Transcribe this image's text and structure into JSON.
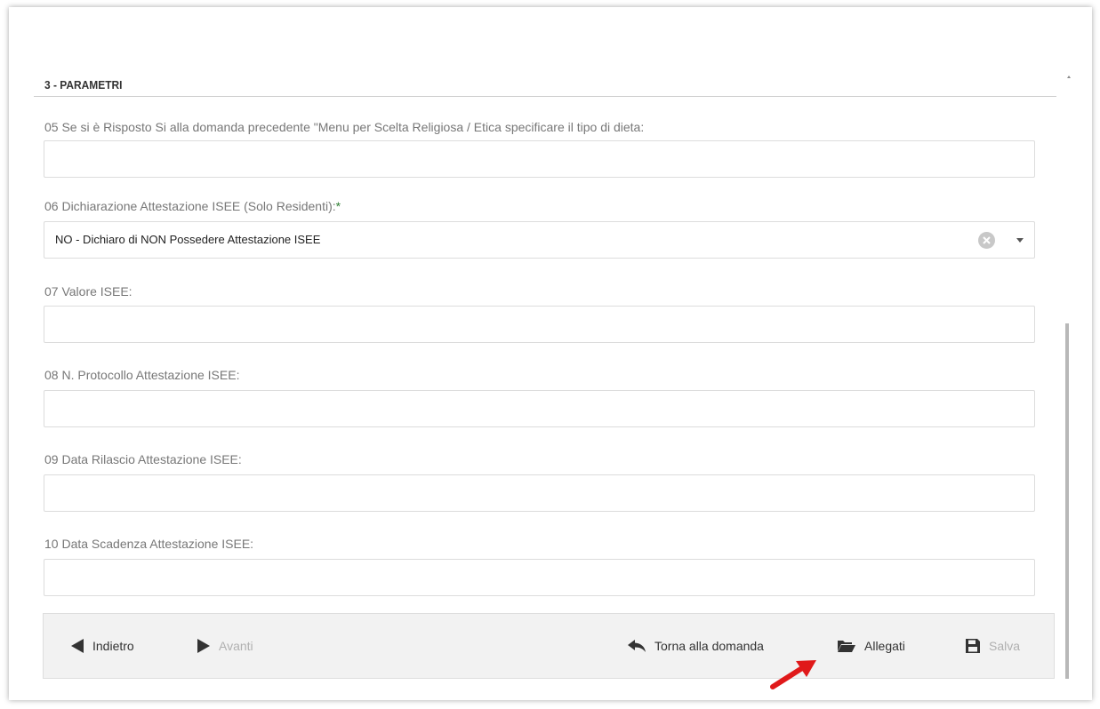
{
  "section": {
    "title": "3 - PARAMETRI"
  },
  "fields": [
    {
      "label": "05 Se si è Risposto Si alla domanda precedente \"Menu per Scelta Religiosa / Etica specificare il tipo di dieta:",
      "value": ""
    },
    {
      "label": "06 Dichiarazione Attestazione ISEE (Solo Residenti):",
      "required": "*",
      "value": "NO - Dichiaro di NON Possedere Attestazione ISEE"
    },
    {
      "label": "07 Valore ISEE:",
      "value": ""
    },
    {
      "label": "08 N. Protocollo Attestazione ISEE:",
      "value": ""
    },
    {
      "label": "09 Data Rilascio Attestazione ISEE:",
      "value": ""
    },
    {
      "label": "10 Data Scadenza Attestazione ISEE:",
      "value": ""
    }
  ],
  "toolbar": {
    "back": {
      "label": "Indietro",
      "icon": "triangle-left-icon"
    },
    "next": {
      "label": "Avanti",
      "icon": "triangle-right-icon",
      "disabled": true
    },
    "return": {
      "label": "Torna alla domanda",
      "icon": "reply-icon"
    },
    "attachments": {
      "label": "Allegati",
      "icon": "folder-open-icon"
    },
    "save": {
      "label": "Salva",
      "icon": "floppy-disk-icon",
      "disabled": true
    }
  },
  "colors": {
    "required": "#2e7d32",
    "annotation_arrow": "#e0191a",
    "toolbar_bg": "#f2f2f2"
  }
}
